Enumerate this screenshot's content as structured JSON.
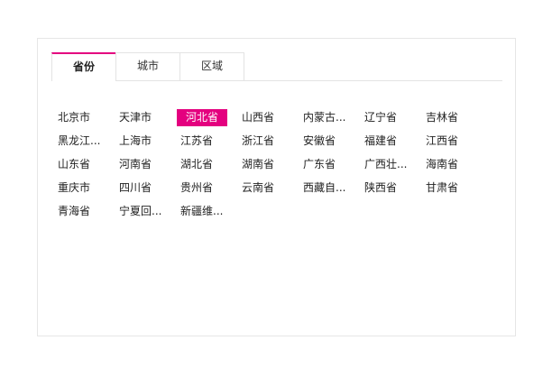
{
  "tabs": [
    {
      "label": "省份"
    },
    {
      "label": "城市"
    },
    {
      "label": "区域"
    }
  ],
  "selected_province": "河北省",
  "provinces": [
    "北京市",
    "天津市",
    "河北省",
    "山西省",
    "内蒙古...",
    "辽宁省",
    "吉林省",
    "黑龙江...",
    "上海市",
    "江苏省",
    "浙江省",
    "安徽省",
    "福建省",
    "江西省",
    "山东省",
    "河南省",
    "湖北省",
    "湖南省",
    "广东省",
    "广西壮...",
    "海南省",
    "重庆市",
    "四川省",
    "贵州省",
    "云南省",
    "西藏自...",
    "陕西省",
    "甘肃省",
    "青海省",
    "宁夏回...",
    "新疆维..."
  ],
  "colors": {
    "accent": "#e4007f",
    "border": "#e3e3e3",
    "text": "#222222"
  }
}
